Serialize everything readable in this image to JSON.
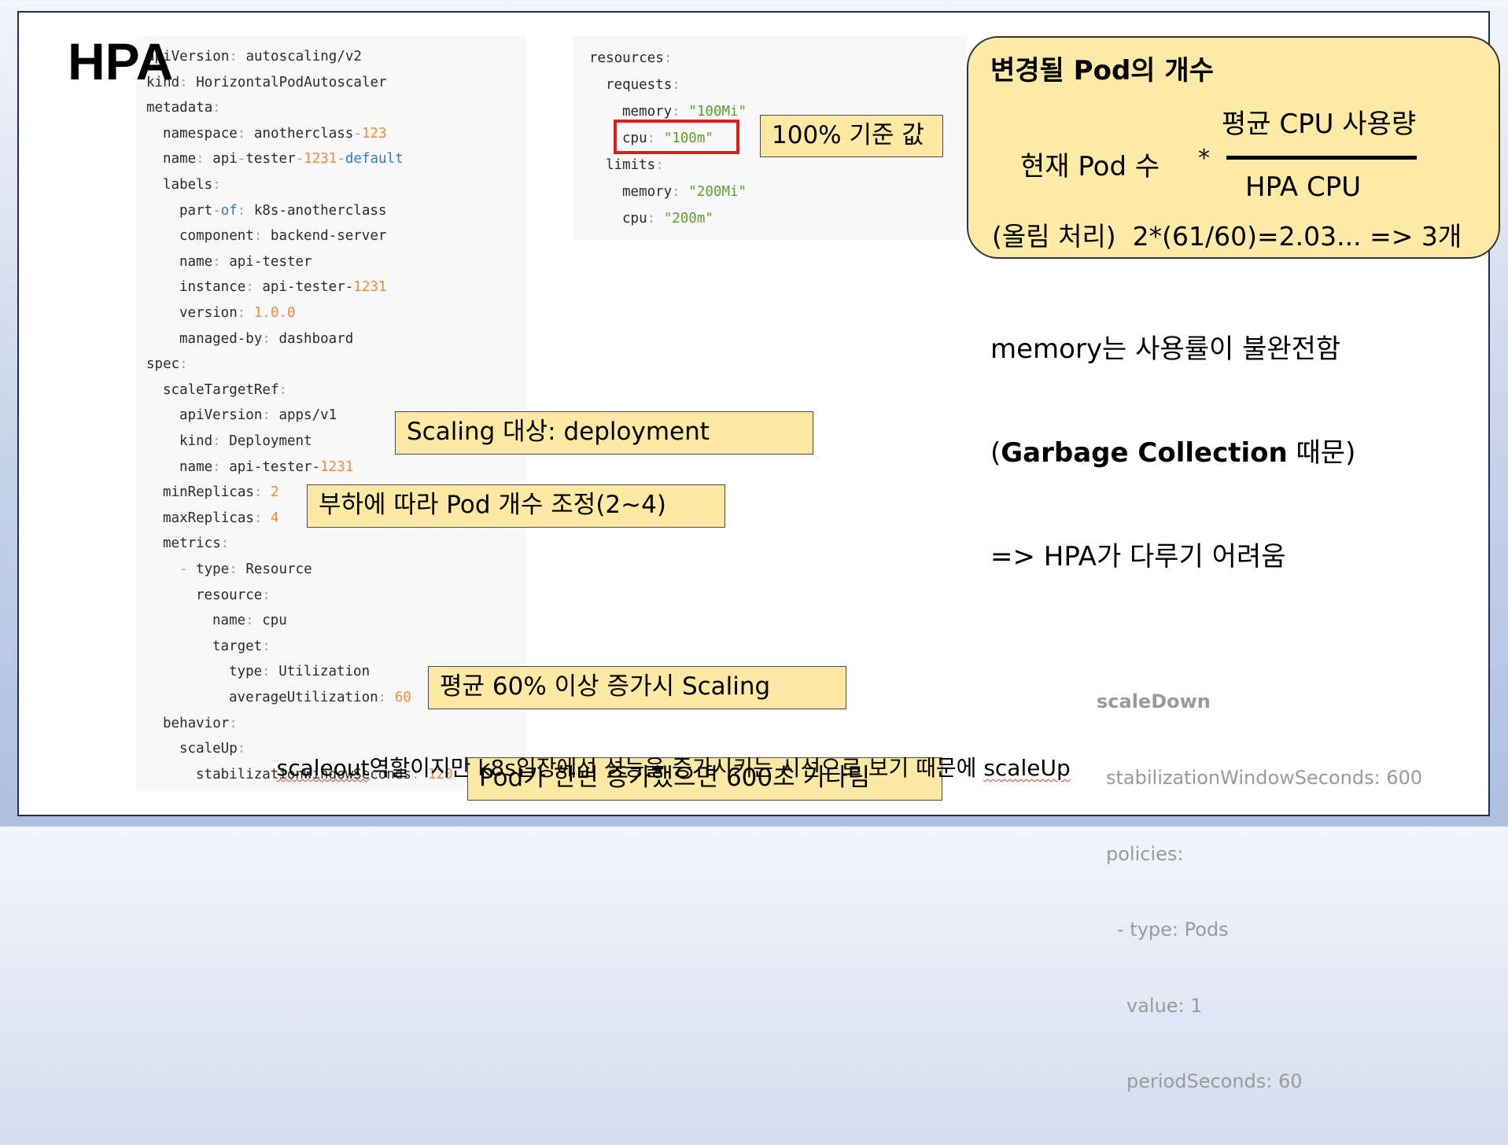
{
  "title": "HPA",
  "yaml_left": {
    "l1": {
      "k": "apiVersion",
      "v": "autoscaling/v2"
    },
    "l2": {
      "k": "kind",
      "v": "HorizontalPodAutoscaler"
    },
    "l3": {
      "k": "metadata"
    },
    "l4": {
      "k": "namespace",
      "v1": "anotherclass",
      "v2": "123"
    },
    "l5": {
      "k": "name",
      "v1": "api",
      "v2": "tester",
      "v3": "1231",
      "v4": "default"
    },
    "l6": {
      "k": "labels"
    },
    "l7": {
      "k1": "part",
      "k2": "of",
      "v": "k8s-anotherclass"
    },
    "l8": {
      "k": "component",
      "v": "backend-server"
    },
    "l9": {
      "k": "name",
      "v": "api-tester"
    },
    "l10": {
      "k": "instance",
      "v1": "api-tester-",
      "v2": "1231"
    },
    "l11": {
      "k": "version",
      "v": "1.0.0"
    },
    "l12": {
      "k": "managed-by",
      "v": "dashboard"
    },
    "l13": {
      "k": "spec"
    },
    "l14": {
      "k": "scaleTargetRef"
    },
    "l15": {
      "k": "apiVersion",
      "v": "apps/v1"
    },
    "l16": {
      "k": "kind",
      "v": "Deployment"
    },
    "l17": {
      "k": "name",
      "v1": "api-tester-",
      "v2": "1231"
    },
    "l18": {
      "k": "minReplicas",
      "v": "2"
    },
    "l19": {
      "k": "maxReplicas",
      "v": "4"
    },
    "l20": {
      "k": "metrics"
    },
    "l21": {
      "k": "type",
      "v": "Resource"
    },
    "l22": {
      "k": "resource"
    },
    "l23": {
      "k": "name",
      "v": "cpu"
    },
    "l24": {
      "k": "target"
    },
    "l25": {
      "k": "type",
      "v": "Utilization"
    },
    "l26": {
      "k": "averageUtilization",
      "v": "60"
    },
    "l27": {
      "k": "behavior"
    },
    "l28": {
      "k": "scaleUp"
    },
    "l29": {
      "k": "stabilizationWindowSeconds",
      "v": "120"
    }
  },
  "yaml_right": {
    "r1": {
      "k": "resources"
    },
    "r2": {
      "k": "requests"
    },
    "r3": {
      "k": "memory",
      "v": "\"100Mi\""
    },
    "r4": {
      "k": "cpu",
      "v": "\"100m\""
    },
    "r5": {
      "k": "limits"
    },
    "r6": {
      "k": "memory",
      "v": "\"200Mi\""
    },
    "r7": {
      "k": "cpu",
      "v": "\"200m\""
    }
  },
  "notes": {
    "cpu_base": "100% 기준 값",
    "scaling_target": "Scaling 대상: deployment",
    "replicas": "부하에 따라 Pod 개수 조정(2~4)",
    "avg_util": "평균 60% 이상 증가시 Scaling",
    "wait": "Pod가 한번 증가했으면 600초 기다림"
  },
  "scaleup_comment": {
    "part1": "scaleout",
    "part2": "역할이지만 k8s입장에선 성능을 증가시키는 시선으로 보기 때문에 ",
    "part3": "scaleUp"
  },
  "formula": {
    "heading": "변경될 Pod의 개수",
    "current": "현재 Pod 수",
    "times": "*",
    "numerator": "평균 CPU 사용량",
    "denominator": "HPA CPU",
    "result": "(올림 처리)  2*(61/60)=2.03... => 3개"
  },
  "memory_note": {
    "line1": "memory는 사용률이 불완전함",
    "line2_open": "(",
    "line2_bold": "Garbage Collection",
    "line2_rest": " 때문)",
    "line3": "=> HPA가 다루기 어려움"
  },
  "scale_down": {
    "l1": "scaleDown",
    "l2": "stabilizationWindowSeconds: 600",
    "l3": "policies:",
    "l4": "- type: Pods",
    "l5": "value: 1",
    "l6": "periodSeconds: 60"
  }
}
